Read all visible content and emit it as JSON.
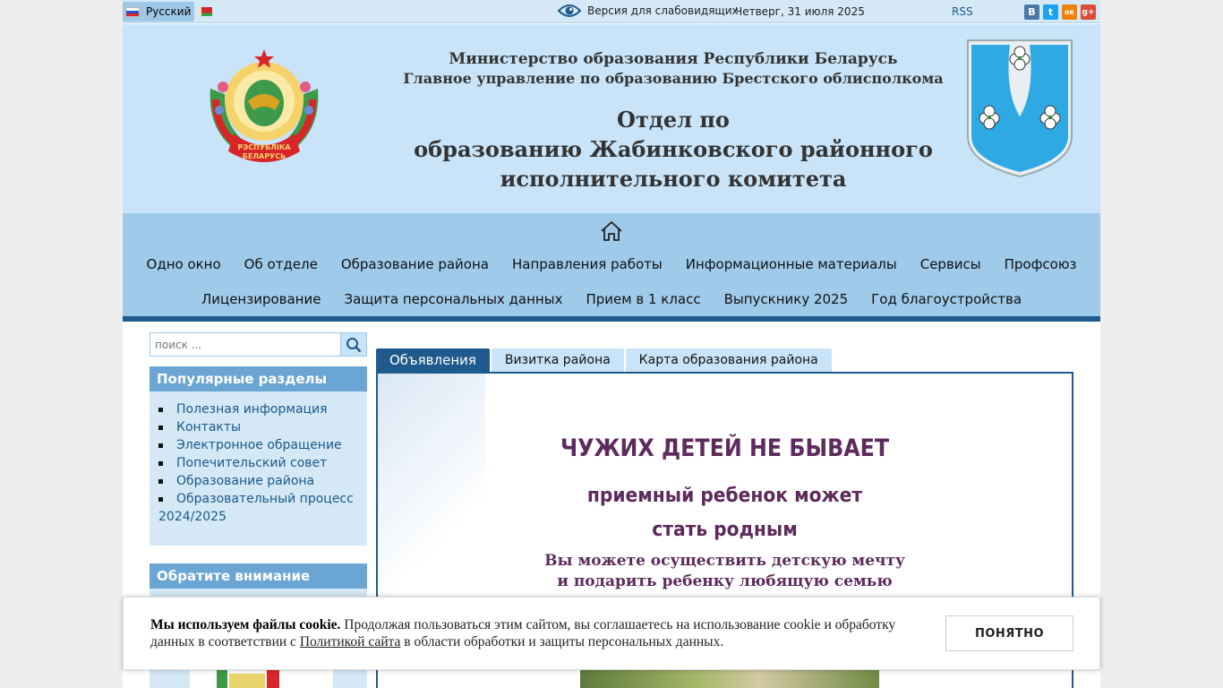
{
  "topbar": {
    "language": "Русский",
    "vision_label": "Версия для слабовидящих",
    "date": "Четверг, 31 июля 2025",
    "rss": "RSS",
    "social": [
      "В",
      "t",
      "ок",
      "g+"
    ],
    "social_colors": [
      "#4a76a8",
      "#1da1f2",
      "#ee8208",
      "#dd4b39"
    ]
  },
  "header": {
    "ministry": "Министерство образования Республики Беларусь",
    "department": "Главное управление по образованию Брестского облисполкома",
    "title_line1": "Отдел по",
    "title_line2": "образованию Жабинковского районного",
    "title_line3": "исполнительного комитета",
    "emblem_text": "РЭСПУБЛІКА БЕЛАРУСЬ"
  },
  "nav": {
    "row1": [
      "Одно окно",
      "Об отделе",
      "Образование района",
      "Направления работы",
      "Информационные материалы",
      "Сервисы",
      "Профсоюз"
    ],
    "row2": [
      "Лицензирование",
      "Защита персональных данных",
      "Прием в 1 класс",
      "Выпускнику 2025",
      "Год благоустройства"
    ]
  },
  "search": {
    "placeholder": "поиск ..."
  },
  "popular": {
    "title": "Популярные разделы",
    "items": [
      "Полезная информация",
      "Контакты",
      "Электронное обращение",
      "Попечительский совет",
      "Образование района",
      "Образовательный процесс 2024/2025"
    ]
  },
  "attention": {
    "title": "Обратите внимание"
  },
  "tabs": [
    "Объявления",
    "Визитка района",
    "Карта образования района"
  ],
  "banner": {
    "headline": "ЧУЖИХ ДЕТЕЙ НЕ БЫВАЕТ",
    "line2": "приемный ребенок может",
    "line3": "стать родным",
    "line4": "Вы можете осуществить детскую мечту",
    "line5": "и подарить ребенку любящую семью"
  },
  "cookie": {
    "bold": "Мы используем файлы cookie.",
    "text1": " Продолжая пользоваться этим сайтом, вы соглашаетесь на использование cookie и обработку данных в соответствии с ",
    "link": "Политикой сайта",
    "text2": " в области обработки и защиты персональных данных.",
    "button": "ПОНЯТНО"
  }
}
